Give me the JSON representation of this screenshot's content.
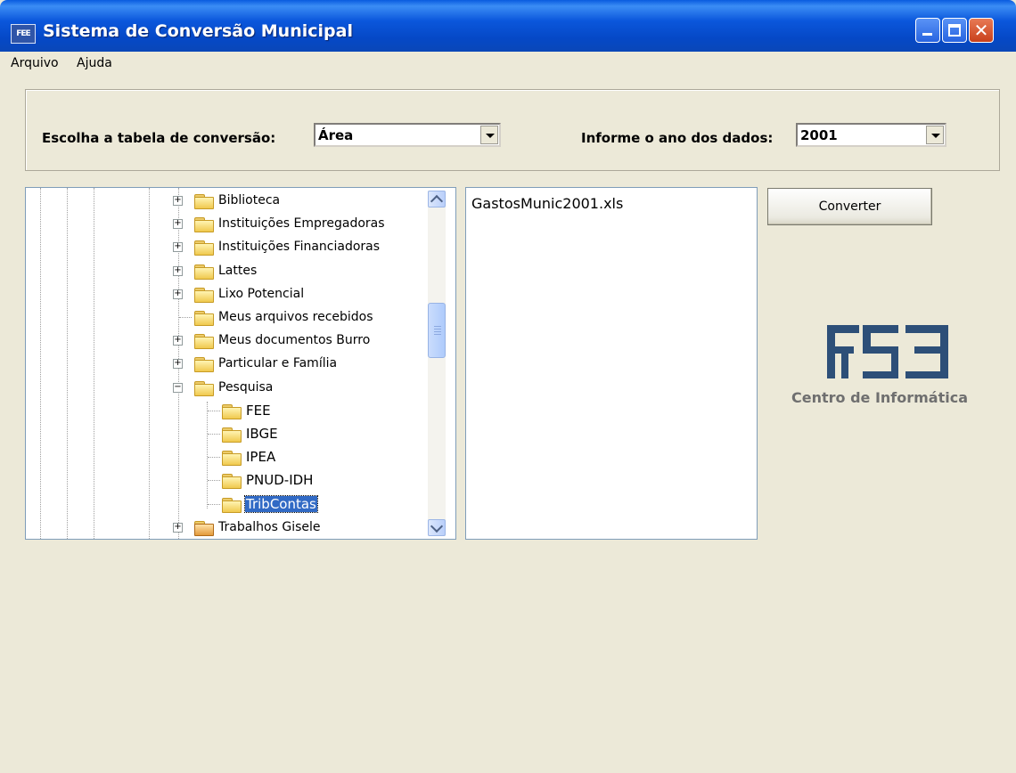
{
  "window": {
    "title": "Sistema de Conversão Municipal",
    "app_icon_text": "FEE"
  },
  "menu": {
    "arquivo": "Arquivo",
    "ajuda": "Ajuda"
  },
  "form": {
    "tabela_label": "Escolha a tabela de conversão:",
    "tabela_value": "Área",
    "ano_label": "Informe o ano dos dados:",
    "ano_value": "2001"
  },
  "tree": {
    "items": [
      {
        "label": "Biblioteca",
        "expander": "+"
      },
      {
        "label": "Instituições Empregadoras",
        "expander": "+"
      },
      {
        "label": "Instituições Financiadoras",
        "expander": "+"
      },
      {
        "label": "Lattes",
        "expander": "+"
      },
      {
        "label": "Lixo Potencial",
        "expander": "+"
      },
      {
        "label": "Meus arquivos recebidos",
        "expander": ""
      },
      {
        "label": "Meus documentos Burro",
        "expander": "+"
      },
      {
        "label": "Particular e Família",
        "expander": "+"
      },
      {
        "label": "Pesquisa",
        "expander": "−"
      },
      {
        "label": "FEE",
        "expander": ""
      },
      {
        "label": "IBGE",
        "expander": ""
      },
      {
        "label": "IPEA",
        "expander": ""
      },
      {
        "label": "PNUD-IDH",
        "expander": ""
      },
      {
        "label": "TribContas",
        "expander": "",
        "selected": true
      },
      {
        "label": "Trabalhos Gisele",
        "expander": "+"
      }
    ]
  },
  "files": {
    "items": [
      "GastosMunic2001.xls"
    ]
  },
  "actions": {
    "converter_label": "Converter"
  },
  "logo": {
    "caption": "Centro de Informática",
    "color": "#2d4f78"
  }
}
